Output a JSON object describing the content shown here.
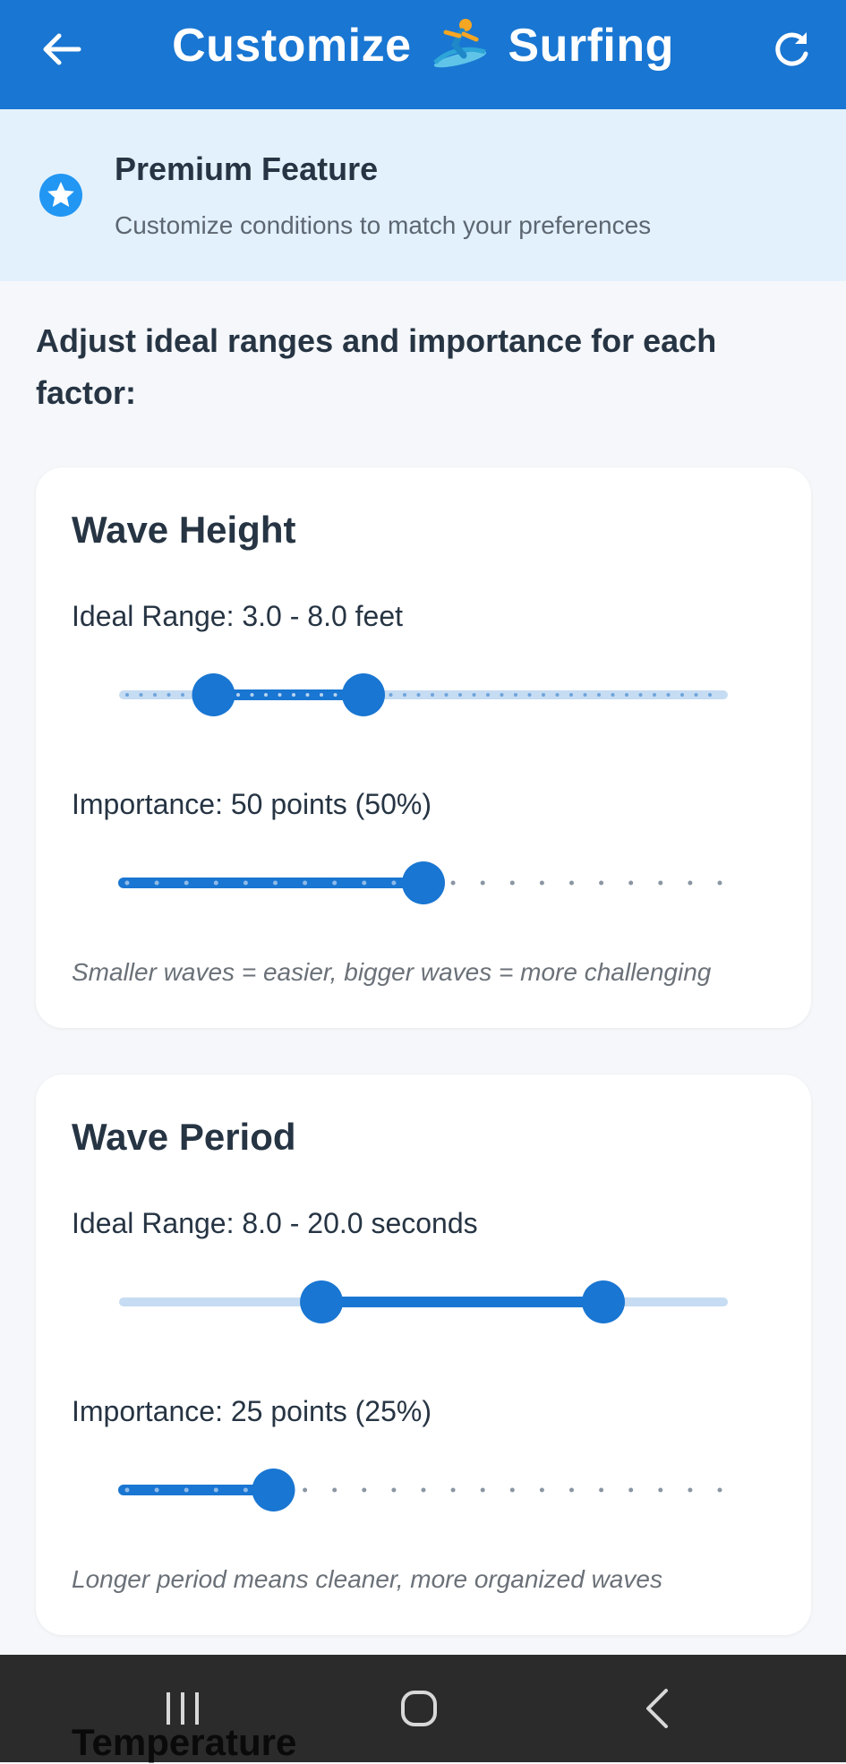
{
  "header": {
    "title_left": "Customize",
    "title_right": "Surfing",
    "emoji_icon": "surfer-emoji"
  },
  "premium": {
    "title": "Premium Feature",
    "subtitle": "Customize conditions to match your preferences",
    "icon": "star-circle-icon"
  },
  "intro": "Adjust ideal ranges and importance for each factor:",
  "colors": {
    "primary": "#1976d2",
    "banner_bg": "#e3f1fc",
    "track_inactive": "#c6dcf2",
    "text_dark": "#263443",
    "nav_bg": "#2b2b2b"
  },
  "cards": [
    {
      "title": "Wave Height",
      "range_label": "Ideal Range: 3.0 - 8.0 feet",
      "range_low_fraction": 0.15,
      "range_high_fraction": 0.4,
      "importance_label": "Importance: 50 points (50%)",
      "importance_fraction": 0.5,
      "note": "Smaller waves = easier, bigger waves = more challenging"
    },
    {
      "title": "Wave Period",
      "range_label": "Ideal Range: 8.0 - 20.0 seconds",
      "range_low_fraction": 0.33,
      "range_high_fraction": 0.8,
      "importance_label": "Importance: 25 points (25%)",
      "importance_fraction": 0.25,
      "note": "Longer period means cleaner, more organized waves"
    }
  ],
  "next_card_title": "Temperature"
}
